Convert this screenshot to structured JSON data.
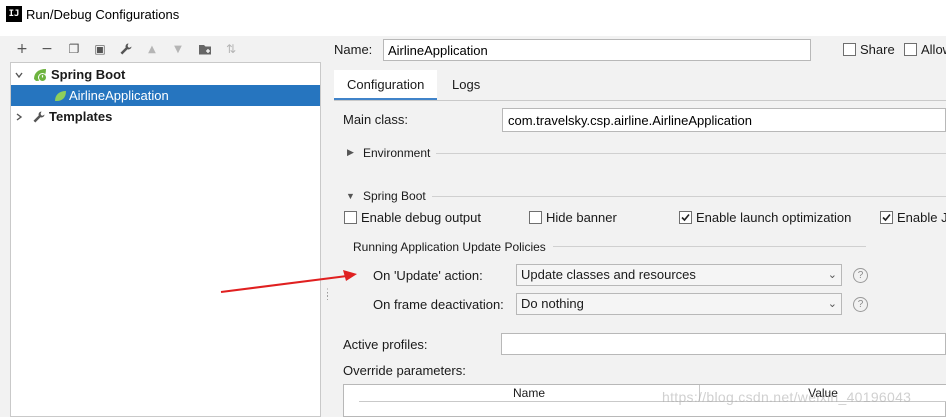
{
  "window": {
    "app_icon": "IJ",
    "title": "Run/Debug Configurations"
  },
  "toolbar": {
    "buttons": [
      {
        "name": "add-icon",
        "glyph": "+"
      },
      {
        "name": "remove-icon",
        "glyph": "−"
      },
      {
        "name": "copy-icon",
        "glyph": "❐"
      },
      {
        "name": "save-icon",
        "glyph": "▣"
      },
      {
        "name": "wrench-icon",
        "glyph": "🔧"
      },
      {
        "name": "move-up-icon",
        "glyph": "▲"
      },
      {
        "name": "move-down-icon",
        "glyph": "▼"
      },
      {
        "name": "folder-icon",
        "glyph": "▰"
      },
      {
        "name": "sort-icon",
        "glyph": "⇅"
      }
    ]
  },
  "tree": {
    "spring_boot_label": "Spring Boot",
    "airline_label": "AirlineApplication",
    "templates_label": "Templates"
  },
  "form": {
    "name_label": "Name:",
    "name_value": "AirlineApplication",
    "share_label": "Share",
    "allow_label": "Allow",
    "tabs": [
      "Configuration",
      "Logs"
    ],
    "main_class_label": "Main class:",
    "main_class_value": "com.travelsky.csp.airline.AirlineApplication",
    "environment_label": "Environment",
    "spring_boot_section": "Spring Boot",
    "enable_debug_label": "Enable debug output",
    "hide_banner_label": "Hide banner",
    "enable_launch_label": "Enable launch optimization",
    "enable_j_label": "Enable J",
    "enable_debug_checked": false,
    "hide_banner_checked": false,
    "enable_launch_checked": true,
    "enable_j_checked": true,
    "policies_label": "Running Application Update Policies",
    "update_action_label": "On 'Update' action:",
    "update_action_value": "Update classes and resources",
    "frame_deactivation_label": "On frame deactivation:",
    "frame_deactivation_value": "Do nothing",
    "help_glyph": "?",
    "active_profiles_label": "Active profiles:",
    "override_params_label": "Override parameters:",
    "table_col_name": "Name",
    "table_col_value": "Value"
  },
  "annotation": {
    "arrow_color": "#e02020"
  },
  "watermark": "https://blog.csdn.net/weixin_40196043",
  "colors": {
    "selection": "#2675bf",
    "tab_underline": "#4083c9"
  }
}
